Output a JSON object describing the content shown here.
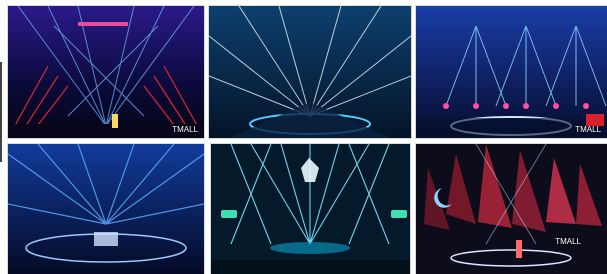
{
  "gallery": {
    "photos": [
      {
        "name": "laser-stage-red-blue",
        "caption": "TMALL"
      },
      {
        "name": "laser-stage-aerial-white",
        "caption": ""
      },
      {
        "name": "laser-stage-pink-dots",
        "caption": "TMALL"
      },
      {
        "name": "laser-stage-blue-tunnel",
        "caption": ""
      },
      {
        "name": "laser-stage-cyan-crown",
        "caption": ""
      },
      {
        "name": "laser-stage-red-shards",
        "caption": "TMALL"
      }
    ]
  },
  "colors": {
    "background": "#ffffff",
    "stage_dark": "#050a22",
    "laser_blue": "#5aa8ff",
    "laser_cyan": "#7fe8ff",
    "laser_red": "#ff2a3a",
    "laser_pink": "#ff4fa0"
  }
}
